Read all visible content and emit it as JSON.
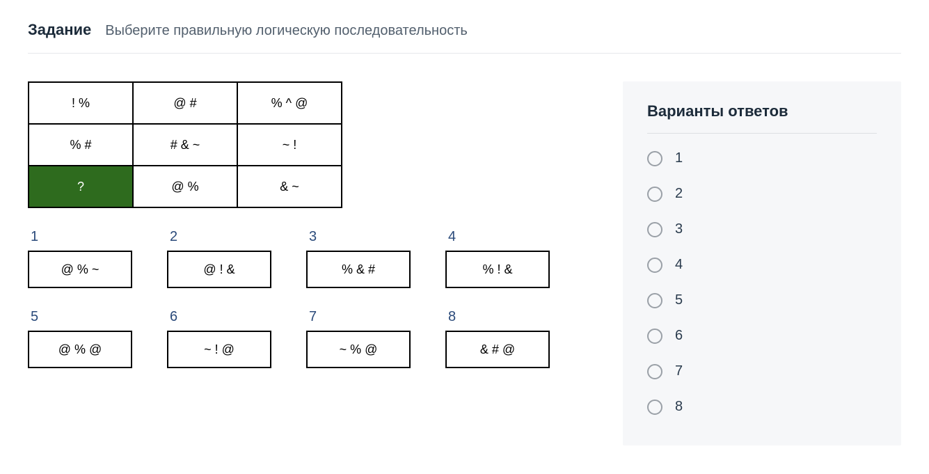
{
  "header": {
    "title": "Задание",
    "subtitle": "Выберите правильную логическую последовательность"
  },
  "grid": [
    [
      {
        "text": "! %",
        "highlight": false
      },
      {
        "text": "@ #",
        "highlight": false
      },
      {
        "text": "% ^ @",
        "highlight": false
      }
    ],
    [
      {
        "text": "% #",
        "highlight": false
      },
      {
        "text": "# & ~",
        "highlight": false
      },
      {
        "text": "~ !",
        "highlight": false
      }
    ],
    [
      {
        "text": "?",
        "highlight": true
      },
      {
        "text": "@ %",
        "highlight": false
      },
      {
        "text": "& ~",
        "highlight": false
      }
    ]
  ],
  "options": [
    {
      "num": "1",
      "text": "@ % ~"
    },
    {
      "num": "2",
      "text": "@ ! &"
    },
    {
      "num": "3",
      "text": "% & #"
    },
    {
      "num": "4",
      "text": "% ! &"
    },
    {
      "num": "5",
      "text": "@ % @"
    },
    {
      "num": "6",
      "text": "~ ! @"
    },
    {
      "num": "7",
      "text": "~ % @"
    },
    {
      "num": "8",
      "text": "& # @"
    }
  ],
  "answers": {
    "title": "Варианты ответов",
    "items": [
      "1",
      "2",
      "3",
      "4",
      "5",
      "6",
      "7",
      "8"
    ]
  }
}
